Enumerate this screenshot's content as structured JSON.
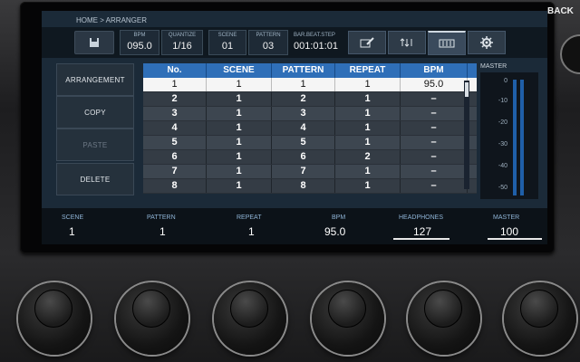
{
  "breadcrumb": "HOME > ARRANGER",
  "back_label": "BACK",
  "header": {
    "bpm_label": "BPM",
    "bpm_value": "095.0",
    "quantize_label": "QUANTIZE",
    "quantize_value": "1/16",
    "scene_label": "SCENE",
    "scene_value": "01",
    "pattern_label": "PATTERN",
    "pattern_value": "03",
    "bbs_label": "BAR.BEAT.STEP",
    "bbs_value": "001:01:01"
  },
  "left_buttons": [
    "ARRANGEMENT",
    "COPY",
    "PASTE",
    "DELETE"
  ],
  "table": {
    "headers": [
      "No.",
      "SCENE",
      "PATTERN",
      "REPEAT",
      "BPM"
    ],
    "rows": [
      [
        "1",
        "1",
        "1",
        "1",
        "95.0"
      ],
      [
        "2",
        "1",
        "2",
        "1",
        "–"
      ],
      [
        "3",
        "1",
        "3",
        "1",
        "–"
      ],
      [
        "4",
        "1",
        "4",
        "1",
        "–"
      ],
      [
        "5",
        "1",
        "5",
        "1",
        "–"
      ],
      [
        "6",
        "1",
        "6",
        "2",
        "–"
      ],
      [
        "7",
        "1",
        "7",
        "1",
        "–"
      ],
      [
        "8",
        "1",
        "8",
        "1",
        "–"
      ]
    ]
  },
  "master": {
    "title": "MASTER",
    "scale": [
      "0",
      "-10",
      "-20",
      "-30",
      "-40",
      "-50"
    ]
  },
  "bottom": {
    "scene_label": "SCENE",
    "scene_value": "1",
    "pattern_label": "PATTERN",
    "pattern_value": "1",
    "repeat_label": "REPEAT",
    "repeat_value": "1",
    "bpm_label": "BPM",
    "bpm_value": "95.0",
    "headphones_label": "HEADPHONES",
    "headphones_value": "127",
    "master_label": "MASTER",
    "master_value": "100"
  },
  "colors": {
    "header_blue": "#2f6fb8",
    "screen_bg": "#1b2a38"
  }
}
